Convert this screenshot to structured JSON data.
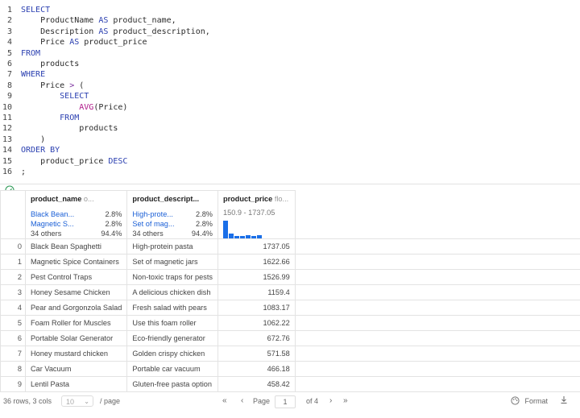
{
  "editor": {
    "lines": [
      {
        "n": "1",
        "parts": [
          {
            "t": "SELECT",
            "c": "kw"
          }
        ]
      },
      {
        "n": "2",
        "parts": [
          {
            "t": "    ProductName ",
            "c": "id"
          },
          {
            "t": "AS",
            "c": "kw"
          },
          {
            "t": " product_name,",
            "c": "id"
          }
        ]
      },
      {
        "n": "3",
        "parts": [
          {
            "t": "    Description ",
            "c": "id"
          },
          {
            "t": "AS",
            "c": "kw"
          },
          {
            "t": " product_description,",
            "c": "id"
          }
        ]
      },
      {
        "n": "4",
        "parts": [
          {
            "t": "    Price ",
            "c": "id"
          },
          {
            "t": "AS",
            "c": "kw"
          },
          {
            "t": " product_price",
            "c": "id"
          }
        ]
      },
      {
        "n": "5",
        "parts": [
          {
            "t": "FROM",
            "c": "kw"
          }
        ]
      },
      {
        "n": "6",
        "parts": [
          {
            "t": "    products",
            "c": "id"
          }
        ]
      },
      {
        "n": "7",
        "parts": [
          {
            "t": "WHERE",
            "c": "kw"
          }
        ]
      },
      {
        "n": "8",
        "parts": [
          {
            "t": "    Price ",
            "c": "id"
          },
          {
            "t": ">",
            "c": "op"
          },
          {
            "t": " (",
            "c": "id"
          }
        ]
      },
      {
        "n": "9",
        "parts": [
          {
            "t": "        SELECT",
            "c": "kw"
          }
        ]
      },
      {
        "n": "10",
        "parts": [
          {
            "t": "            ",
            "c": "id"
          },
          {
            "t": "AVG",
            "c": "fn"
          },
          {
            "t": "(Price)",
            "c": "id"
          }
        ]
      },
      {
        "n": "11",
        "parts": [
          {
            "t": "        FROM",
            "c": "kw"
          }
        ]
      },
      {
        "n": "12",
        "parts": [
          {
            "t": "            products",
            "c": "id"
          }
        ]
      },
      {
        "n": "13",
        "parts": [
          {
            "t": "    )",
            "c": "id"
          }
        ]
      },
      {
        "n": "14",
        "parts": [
          {
            "t": "ORDER BY",
            "c": "kw"
          }
        ]
      },
      {
        "n": "15",
        "parts": [
          {
            "t": "    product_price ",
            "c": "id"
          },
          {
            "t": "DESC",
            "c": "kw"
          }
        ]
      },
      {
        "n": "16",
        "parts": [
          {
            "t": ";",
            "c": "id"
          }
        ]
      }
    ]
  },
  "status_icon": "check-circle-icon",
  "columns": [
    {
      "name": "product_name",
      "type": "o...",
      "summary": {
        "kind": "categorical",
        "top": [
          {
            "value": "Black Bean...",
            "pct": "2.8%"
          },
          {
            "value": "Magnetic S...",
            "pct": "2.8%"
          }
        ],
        "others": {
          "label": "34 others",
          "pct": "94.4%"
        }
      }
    },
    {
      "name": "product_descript...",
      "type": "",
      "summary": {
        "kind": "categorical",
        "top": [
          {
            "value": "High-prote...",
            "pct": "2.8%"
          },
          {
            "value": "Set of mag...",
            "pct": "2.8%"
          }
        ],
        "others": {
          "label": "34 others",
          "pct": "94.4%"
        }
      }
    },
    {
      "name": "product_price",
      "type": "flo...",
      "summary": {
        "kind": "numeric",
        "range": "150.9 - 1737.05",
        "histogram": [
          1.0,
          0.25,
          0.12,
          0.12,
          0.18,
          0.12,
          0.18
        ]
      }
    }
  ],
  "rows": [
    {
      "idx": "0",
      "name": "Black Bean Spaghetti",
      "desc": "High-protein pasta",
      "price": "1737.05"
    },
    {
      "idx": "1",
      "name": "Magnetic Spice Containers",
      "desc": "Set of magnetic jars",
      "price": "1622.66"
    },
    {
      "idx": "2",
      "name": "Pest Control Traps",
      "desc": "Non-toxic traps for pests",
      "price": "1526.99"
    },
    {
      "idx": "3",
      "name": "Honey Sesame Chicken",
      "desc": "A delicious chicken dish",
      "price": "1159.4"
    },
    {
      "idx": "4",
      "name": "Pear and Gorgonzola Salad",
      "desc": "Fresh salad with pears",
      "price": "1083.17"
    },
    {
      "idx": "5",
      "name": "Foam Roller for Muscles",
      "desc": "Use this foam roller",
      "price": "1062.22"
    },
    {
      "idx": "6",
      "name": "Portable Solar Generator",
      "desc": "Eco-friendly generator",
      "price": "672.76"
    },
    {
      "idx": "7",
      "name": "Honey mustard chicken",
      "desc": "Golden crispy chicken",
      "price": "571.58"
    },
    {
      "idx": "8",
      "name": "Car Vacuum",
      "desc": "Portable car vacuum",
      "price": "466.18"
    },
    {
      "idx": "9",
      "name": "Lentil Pasta",
      "desc": "Gluten-free pasta option",
      "price": "458.42"
    }
  ],
  "footer": {
    "summary": "36 rows, 3 cols",
    "page_size": "10",
    "per_page": "/ page",
    "page_label": "Page",
    "page_value": "1",
    "of_label": "of 4",
    "format_label": "Format"
  }
}
